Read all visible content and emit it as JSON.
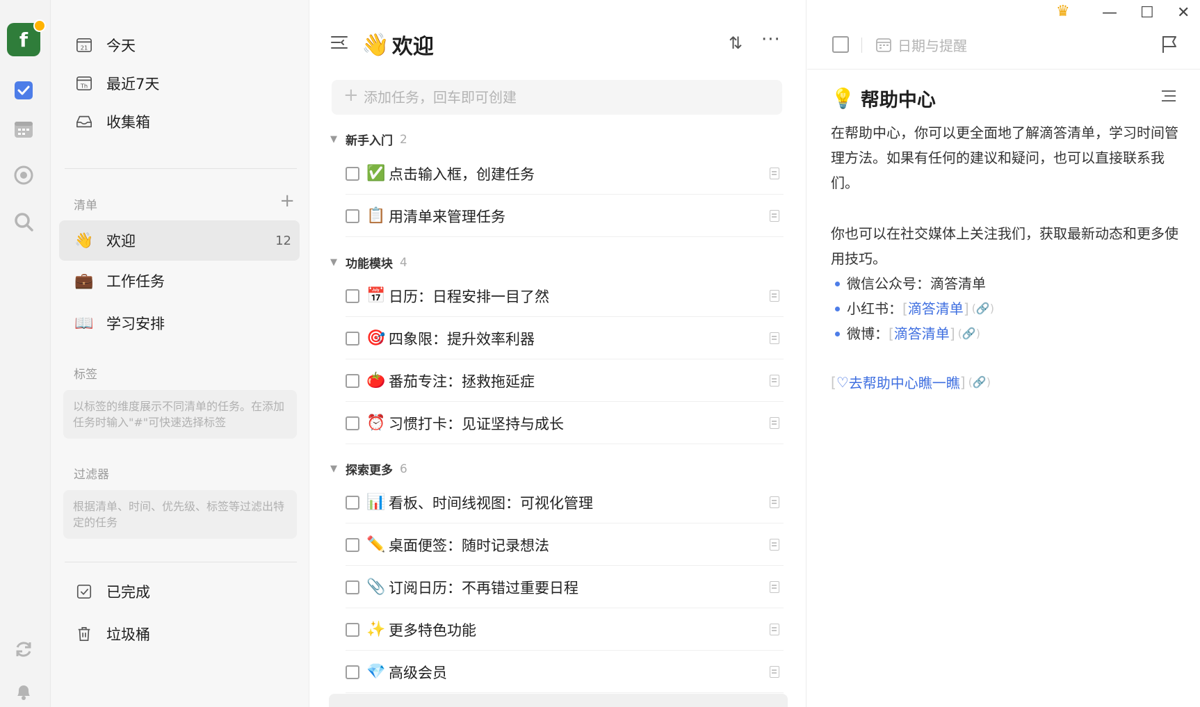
{
  "rail": {
    "avatar_letter": "f",
    "icons": [
      "checkbox-icon",
      "calendar-icon",
      "focus-icon",
      "search-icon",
      "sync-icon",
      "bell-icon"
    ]
  },
  "sidebar": {
    "smart_lists": [
      {
        "icon": "calendar-21-icon",
        "label": "今天"
      },
      {
        "icon": "calendar-th-icon",
        "label": "最近7天"
      },
      {
        "icon": "inbox-icon",
        "label": "收集箱"
      }
    ],
    "lists_label": "清单",
    "lists": [
      {
        "emoji": "👋",
        "label": "欢迎",
        "count": "12",
        "active": true
      },
      {
        "emoji": "💼",
        "label": "工作任务",
        "count": ""
      },
      {
        "emoji": "📖",
        "label": "学习安排",
        "count": ""
      }
    ],
    "tags_label": "标签",
    "tags_hint": "以标签的维度展示不同清单的任务。在添加任务时输入\"#\"可快速选择标签",
    "filters_label": "过滤器",
    "filters_hint": "根据清单、时间、优先级、标签等过滤出特定的任务",
    "bottom": [
      {
        "icon": "completed-icon",
        "label": "已完成"
      },
      {
        "icon": "trash-icon",
        "label": "垃圾桶"
      }
    ]
  },
  "main": {
    "title_emoji": "👋",
    "title": "欢迎",
    "add_placeholder": "添加任务，回车即可创建",
    "groups": [
      {
        "name": "新手入门",
        "count": "2",
        "tasks": [
          {
            "emoji": "✅",
            "text": "点击输入框，创建任务"
          },
          {
            "emoji": "📋",
            "text": "用清单来管理任务"
          }
        ]
      },
      {
        "name": "功能模块",
        "count": "4",
        "tasks": [
          {
            "emoji": "📅",
            "text": "日历：日程安排一目了然"
          },
          {
            "emoji": "🎯",
            "text": "四象限：提升效率利器"
          },
          {
            "emoji": "🍅",
            "text": "番茄专注：拯救拖延症"
          },
          {
            "emoji": "⏰",
            "text": "习惯打卡：见证坚持与成长"
          }
        ]
      },
      {
        "name": "探索更多",
        "count": "6",
        "tasks": [
          {
            "emoji": "📊",
            "text": "看板、时间线视图：可视化管理"
          },
          {
            "emoji": "✏️",
            "text": "桌面便签：随时记录想法"
          },
          {
            "emoji": "📎",
            "text": "订阅日历：不再错过重要日程"
          },
          {
            "emoji": "✨",
            "text": "更多特色功能"
          },
          {
            "emoji": "💎",
            "text": "高级会员"
          }
        ]
      }
    ]
  },
  "detail": {
    "date_placeholder": "日期与提醒",
    "title_emoji": "💡",
    "title": "帮助中心",
    "paragraph1": "在帮助中心，你可以更全面地了解滴答清单，学习时间管理方法。如果有任何的建议和疑问，也可以直接联系我们。",
    "paragraph2": "你也可以在社交媒体上关注我们，获取最新动态和更多使用技巧。",
    "bullets": [
      {
        "prefix": "微信公众号：滴答清单",
        "link": ""
      },
      {
        "prefix": "小红书：",
        "link": "滴答清单"
      },
      {
        "prefix": "微博：",
        "link": "滴答清单"
      }
    ],
    "help_link": "去帮助中心瞧一瞧"
  },
  "colors": {
    "accent": "#4d7de8",
    "avatar_bg": "#2f7d3a",
    "crown": "#f0a500",
    "link": "#3f6fe0"
  }
}
